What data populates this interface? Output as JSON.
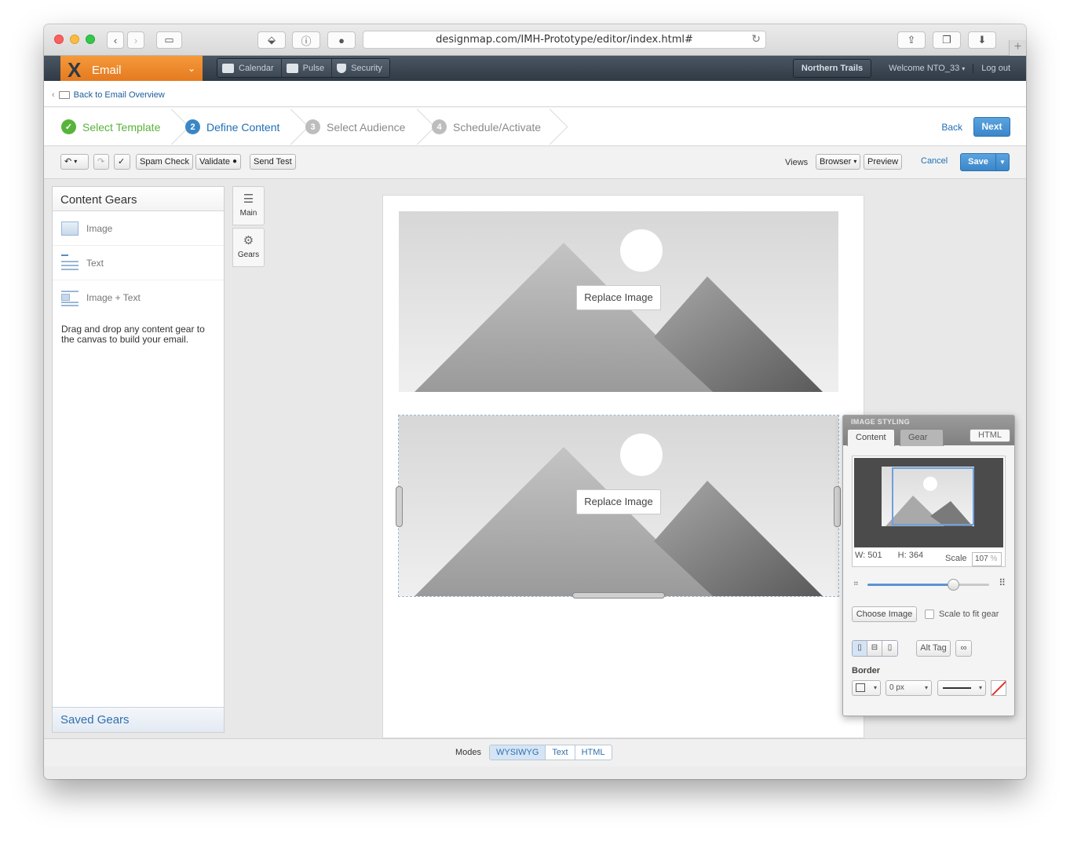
{
  "browser": {
    "url": "designmap.com/IMH-Prototype/editor/index.html#"
  },
  "app": {
    "product_label": "Email",
    "nav": [
      {
        "label": "Calendar",
        "icon": "calendar-icon"
      },
      {
        "label": "Pulse",
        "icon": "pulse-icon"
      },
      {
        "label": "Security",
        "icon": "shield-icon"
      }
    ],
    "org_label": "Northern Trails",
    "welcome_label": "Welcome NTO_33",
    "logout_label": "Log out"
  },
  "breadcrumb": {
    "label": "Back to Email Overview"
  },
  "wizard": {
    "steps": [
      {
        "num": "✓",
        "label": "Select Template",
        "state": "done"
      },
      {
        "num": "2",
        "label": "Define Content",
        "state": "active"
      },
      {
        "num": "3",
        "label": "Select Audience",
        "state": "todo"
      },
      {
        "num": "4",
        "label": "Schedule/Activate",
        "state": "todo"
      }
    ],
    "back_label": "Back",
    "next_label": "Next"
  },
  "toolbar": {
    "spam_check": "Spam Check",
    "validate": "Validate",
    "send_test": "Send Test",
    "views_label": "Views",
    "browser_select": "Browser",
    "preview": "Preview",
    "cancel": "Cancel",
    "save": "Save"
  },
  "sidebar": {
    "title": "Content Gears",
    "items": [
      {
        "label": "Image"
      },
      {
        "label": "Text"
      },
      {
        "label": "Image + Text"
      }
    ],
    "help_text": "Drag and drop any content gear to the canvas to build your email.",
    "saved_gears": "Saved Gears"
  },
  "vtabs": {
    "main": "Main",
    "gears": "Gears"
  },
  "canvas": {
    "replace_image_label": "Replace Image"
  },
  "modes": {
    "label": "Modes",
    "options": [
      "WYSIWYG",
      "Text",
      "HTML"
    ],
    "active": "WYSIWYG"
  },
  "image_styling": {
    "title": "IMAGE STYLING",
    "tab_content": "Content",
    "tab_gear": "Gear",
    "tab_html": "HTML",
    "width": "W: 501",
    "height": "H: 364",
    "scale_label": "Scale",
    "scale_value": "107",
    "scale_unit": "%",
    "scale_slider_fraction": 0.7,
    "choose_image": "Choose Image",
    "scale_to_fit": "Scale to fit gear",
    "alt_tag": "Alt Tag",
    "border_label": "Border",
    "border_width": "0 px"
  },
  "colors": {
    "accent_orange": "#e8801f",
    "header_dark": "#36414c",
    "link_blue": "#1f6fb5",
    "step_done_green": "#58b33a"
  }
}
